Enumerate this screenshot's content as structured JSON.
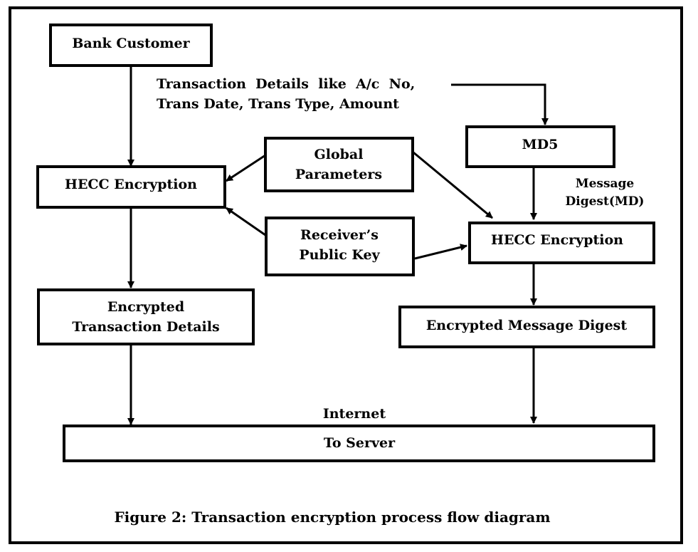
{
  "diagram": {
    "nodes": {
      "bank_customer": "Bank Customer",
      "hecc_left": "HECC Encryption",
      "global_params_l1": "Global",
      "global_params_l2": "Parameters",
      "receiver_key_l1": "Receiver’s",
      "receiver_key_l2": "Public Key",
      "md5": "MD5",
      "hecc_right": "HECC Encryption",
      "enc_details_l1": "Encrypted",
      "enc_details_l2": "Transaction Details",
      "enc_digest": "Encrypted Message Digest",
      "to_server": "To Server"
    },
    "labels": {
      "transaction_l1": "Transaction  Details  like  A/c  No,",
      "transaction_l2": "Trans Date, Trans Type, Amount",
      "message_digest_l1": "Message",
      "message_digest_l2": "Digest(MD)",
      "internet": "Internet"
    },
    "edges": [
      {
        "from": "bank_customer",
        "to": "hecc_left"
      },
      {
        "from": "transaction_details",
        "to": "md5"
      },
      {
        "from": "global_params",
        "to": "hecc_left"
      },
      {
        "from": "global_params",
        "to": "hecc_right"
      },
      {
        "from": "receiver_key",
        "to": "hecc_left"
      },
      {
        "from": "receiver_key",
        "to": "hecc_right"
      },
      {
        "from": "md5",
        "to": "hecc_right",
        "label": "Message Digest(MD)"
      },
      {
        "from": "hecc_left",
        "to": "enc_details"
      },
      {
        "from": "hecc_right",
        "to": "enc_digest"
      },
      {
        "from": "enc_details",
        "to": "to_server"
      },
      {
        "from": "enc_digest",
        "to": "to_server"
      }
    ],
    "caption": "Figure 2: Transaction encryption process flow diagram"
  }
}
